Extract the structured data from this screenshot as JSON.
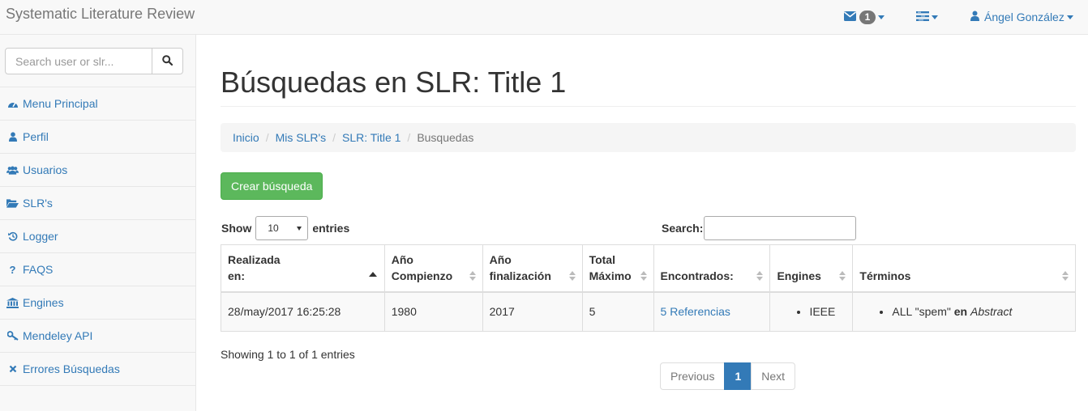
{
  "navbar": {
    "brand": "Systematic Literature Review",
    "messages_count": "1",
    "user_name": "Ángel González"
  },
  "sidebar": {
    "search_placeholder": "Search user or slr...",
    "items": [
      {
        "label": "Menu Principal",
        "icon": "dashboard-icon"
      },
      {
        "label": "Perfil",
        "icon": "user-icon"
      },
      {
        "label": "Usuarios",
        "icon": "users-icon"
      },
      {
        "label": "SLR's",
        "icon": "folder-open-icon"
      },
      {
        "label": "Logger",
        "icon": "history-icon"
      },
      {
        "label": "FAQS",
        "icon": "question-icon"
      },
      {
        "label": "Engines",
        "icon": "bank-icon"
      },
      {
        "label": "Mendeley API",
        "icon": "key-icon"
      },
      {
        "label": "Errores Búsquedas",
        "icon": "times-icon"
      }
    ]
  },
  "main": {
    "title": "Búsquedas en SLR: Title 1",
    "breadcrumb": [
      "Inicio",
      "Mis SLR's",
      "SLR: Title 1",
      "Busquedas"
    ],
    "create_button": "Crear búsqueda",
    "show_label": "Show",
    "entries_label": "entries",
    "page_length": "10",
    "search_label": "Search:",
    "table": {
      "headers": [
        "Realizada en:",
        "Año Compienzo",
        "Año finalización",
        "Total Máximo",
        "Encontrados:",
        "Engines",
        "Términos"
      ],
      "rows": [
        {
          "realizada": "28/may/2017 16:25:28",
          "anio_comienzo": "1980",
          "anio_fin": "2017",
          "total_max": "5",
          "encontrados": "5 Referencias",
          "engine": "IEEE",
          "term_prefix": "ALL \"spem\"",
          "term_en": "en",
          "term_field": "Abstract"
        }
      ]
    },
    "info": "Showing 1 to 1 of 1 entries",
    "pager": {
      "previous": "Previous",
      "current": "1",
      "next": "Next"
    }
  },
  "colors": {
    "link": "#337ab7",
    "success": "#5cb85c",
    "navbar_bg": "#f8f8f8"
  }
}
